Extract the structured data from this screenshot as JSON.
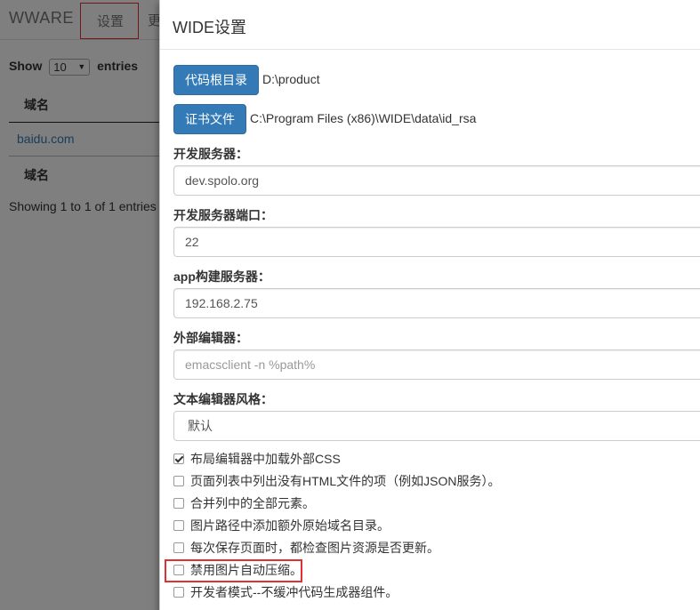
{
  "navbar": {
    "brand": "WWARE",
    "settings_label": "设置",
    "more_label": "更"
  },
  "table": {
    "show_label": "Show",
    "show_value": "10",
    "entries_label": "entries",
    "header_domain": "域名",
    "rows": [
      "baidu.com"
    ],
    "footer_domain": "域名",
    "showing_text": "Showing 1 to 1 of 1 entries"
  },
  "modal": {
    "title": "WIDE设置",
    "code_root_button": "代码根目录",
    "code_root_path": "D:\\product",
    "cert_button": "证书文件",
    "cert_path": "C:\\Program Files (x86)\\WIDE\\data\\id_rsa",
    "dev_server_label": "开发服务器：",
    "dev_server_value": "dev.spolo.org",
    "dev_port_label": "开发服务器端口：",
    "dev_port_value": "22",
    "app_build_label": "app构建服务器：",
    "app_build_value": "192.168.2.75",
    "external_editor_label": "外部编辑器：",
    "external_editor_placeholder": "emacsclient -n %path%",
    "text_editor_style_label": "文本编辑器风格：",
    "text_editor_style_value": "默认",
    "checkboxes": [
      {
        "label": "布局编辑器中加载外部CSS",
        "checked": true
      },
      {
        "label": "页面列表中列出没有HTML文件的项（例如JSON服务）。",
        "checked": false
      },
      {
        "label": "合并列中的全部元素。",
        "checked": false
      },
      {
        "label": "图片路径中添加额外原始域名目录。",
        "checked": false
      },
      {
        "label": "每次保存页面时，都检查图片资源是否更新。",
        "checked": false
      },
      {
        "label": "禁用图片自动压缩。",
        "checked": false
      },
      {
        "label": "开发者模式--不缓冲代码生成器组件。",
        "checked": false
      }
    ]
  },
  "colors": {
    "primary": "#337ab7",
    "highlight": "#e03030"
  }
}
